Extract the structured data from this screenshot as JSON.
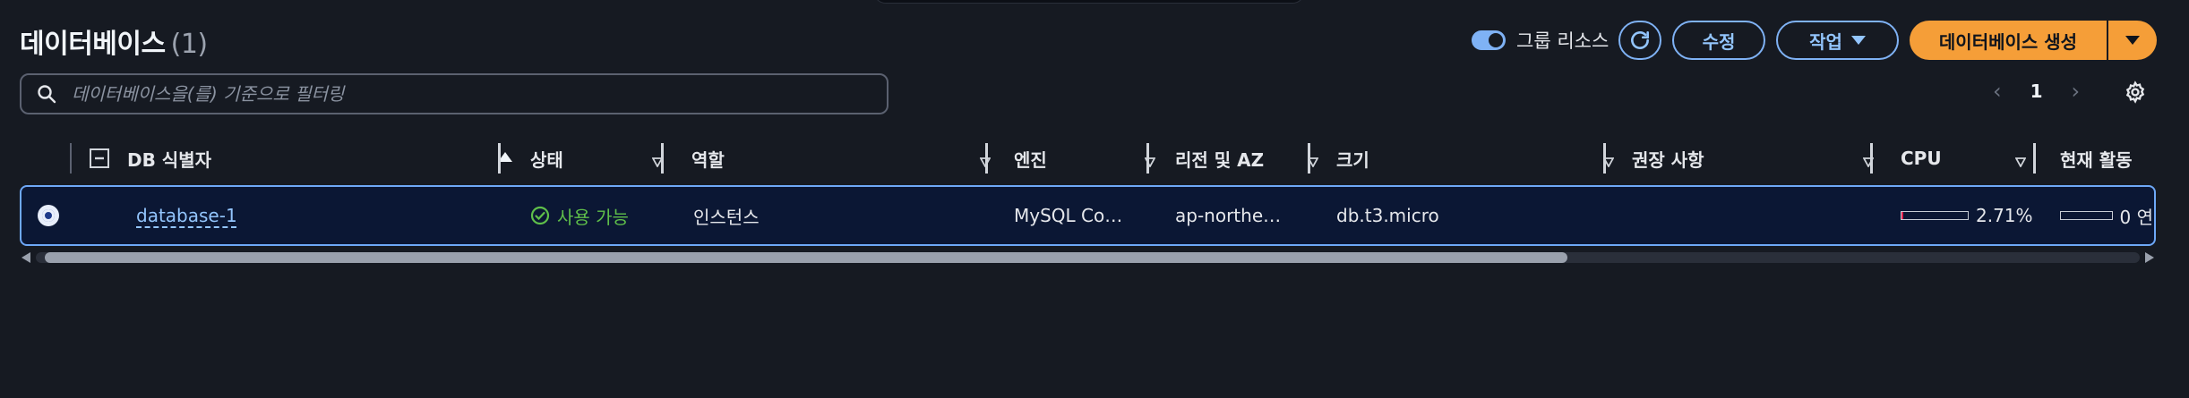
{
  "header": {
    "title": "데이터베이스",
    "count": "(1)",
    "group_resources_label": "그룹 리소스",
    "group_resources_on": true,
    "edit_label": "수정",
    "actions_label": "작업",
    "create_label": "데이터베이스 생성"
  },
  "search": {
    "placeholder": "데이터베이스을(를) 기준으로 필터링",
    "value": ""
  },
  "pagination": {
    "page": "1"
  },
  "table": {
    "columns": [
      "DB 식별자",
      "상태",
      "역할",
      "엔진",
      "리전 및 AZ",
      "크기",
      "권장 사항",
      "CPU",
      "현재 활동"
    ],
    "rows": [
      {
        "identifier": "database-1",
        "status": "사용 가능",
        "role": "인스턴스",
        "engine": "MySQL Co…",
        "region": "ap-northe…",
        "size": "db.t3.micro",
        "recommendations": "",
        "cpu": "2.71%",
        "cpu_fraction": 0.0271,
        "activity": "0 연",
        "activity_fraction": 0
      }
    ]
  },
  "colors": {
    "background": "#161a22",
    "accent": "#7fb2f5",
    "primary": "#f59e38",
    "success": "#5fbf4a",
    "selected_row": "#0b1734"
  },
  "icons": [
    "search-icon",
    "refresh-icon",
    "caret-down-icon",
    "chevron-left-icon",
    "chevron-right-icon",
    "settings-icon",
    "success-icon",
    "sort-ascending-icon",
    "sort-icon"
  ]
}
